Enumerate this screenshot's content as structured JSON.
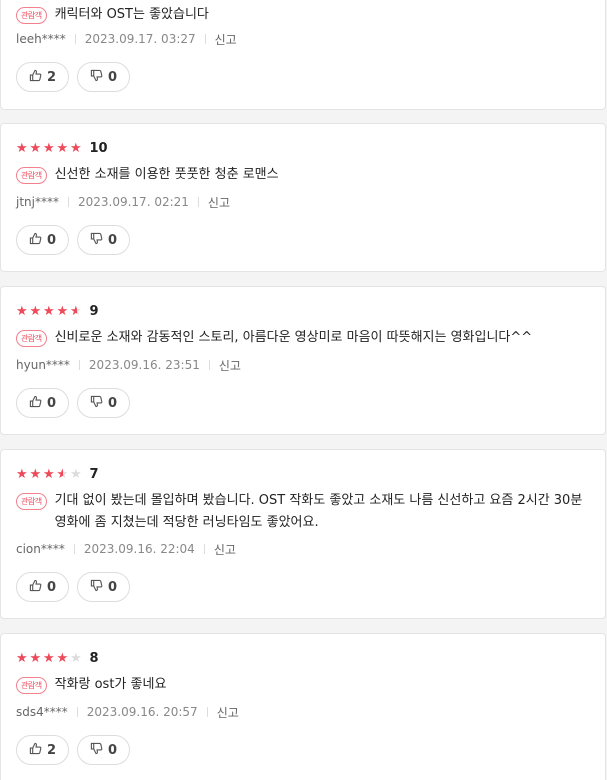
{
  "badge_label": "관람객",
  "report_label": "신고",
  "colors": {
    "star": "#ef4a5a",
    "star_empty": "#dcdcdc",
    "badge": "#ef4a5a"
  },
  "reviews": [
    {
      "rating": null,
      "score": null,
      "text": "캐릭터와 OST는 좋았습니다",
      "user": "leeh****",
      "date": "2023.09.17. 03:27",
      "likes": "2",
      "dislikes": "0"
    },
    {
      "rating": 5,
      "score": "10",
      "text": "신선한 소재를 이용한 풋풋한 청춘 로맨스",
      "user": "jtnj****",
      "date": "2023.09.17. 02:21",
      "likes": "0",
      "dislikes": "0"
    },
    {
      "rating": 4.5,
      "score": "9",
      "text": "신비로운 소재와 감동적인 스토리, 아름다운 영상미로 마음이 따뜻해지는 영화입니다^^",
      "user": "hyun****",
      "date": "2023.09.16. 23:51",
      "likes": "0",
      "dislikes": "0"
    },
    {
      "rating": 3.5,
      "score": "7",
      "text": "기대 없이 봤는데 몰입하며 봤습니다. OST 작화도 좋았고 소재도 나름 신선하고 요즘 2시간 30분 영화에 좀 지쳤는데 적당한 러닝타임도 좋았어요.",
      "user": "cion****",
      "date": "2023.09.16. 22:04",
      "likes": "0",
      "dislikes": "0"
    },
    {
      "rating": 4,
      "score": "8",
      "text": "작화랑 ost가 좋네요",
      "user": "sds4****",
      "date": "2023.09.16. 20:57",
      "likes": "2",
      "dislikes": "0"
    }
  ]
}
